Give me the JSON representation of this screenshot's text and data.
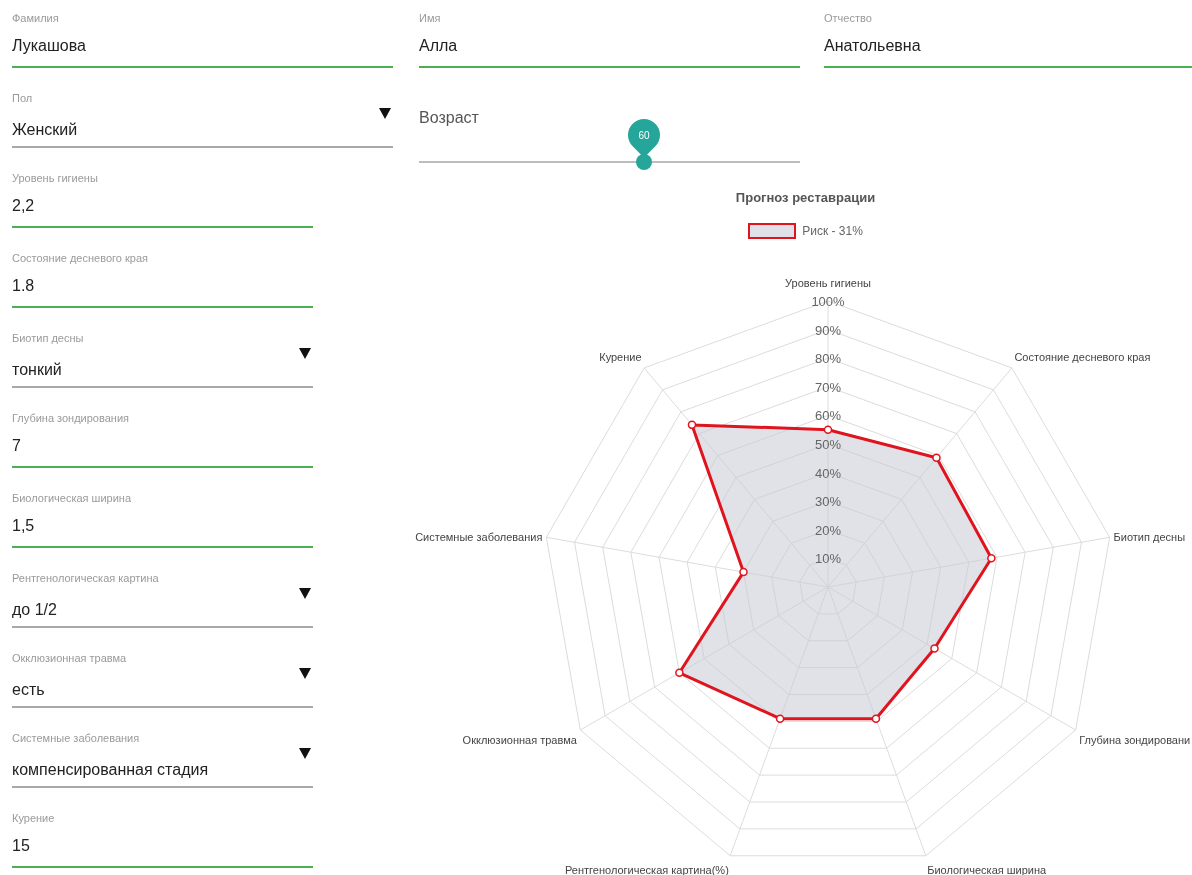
{
  "person": [
    {
      "label": "Фамилия",
      "value": "Лукашова"
    },
    {
      "label": "Имя",
      "value": "Алла"
    },
    {
      "label": "Отчество",
      "value": "Анатольевна"
    }
  ],
  "gender": {
    "kind": "select",
    "label": "Пол",
    "value": "Женский"
  },
  "clinical_fields": [
    {
      "kind": "text",
      "label": "Уровень гигиены",
      "value": "2,2"
    },
    {
      "kind": "text",
      "label": "Состояние десневого края",
      "value": "1.8"
    },
    {
      "kind": "select",
      "label": "Биотип десны",
      "value": "тонкий"
    },
    {
      "kind": "text",
      "label": "Глубина зондирования",
      "value": "7"
    },
    {
      "kind": "text",
      "label": "Биологическая ширина",
      "value": "1,5"
    },
    {
      "kind": "select",
      "label": "Рентгенологическая картина",
      "value": "до 1/2"
    },
    {
      "kind": "select",
      "label": "Окклюзионная травма",
      "value": "есть"
    },
    {
      "kind": "select",
      "label": "Системные заболевания",
      "value": "компенсированная стадия"
    },
    {
      "kind": "text",
      "label": "Курение",
      "value": "15"
    }
  ],
  "age": {
    "label": "Возраст",
    "value": "60",
    "level": 0.59
  },
  "chart": {
    "chart_data": {
      "type": "radar",
      "title": "Прогноз реставрации",
      "categories": [
        "Уровень гигиены",
        "Состояние десневого края",
        "Биотип десны",
        "Глубина зондировани",
        "Биологическая ширина",
        "Рентгенологическая картина(%)",
        "Окклюзионная травма",
        "Системные заболевания",
        "Курение"
      ],
      "series": [
        {
          "name": "Риск - 31%",
          "color": "#e0141e",
          "values": [
            55,
            59,
            58,
            43,
            49,
            49,
            60,
            30,
            74
          ]
        }
      ],
      "ylim": [
        0,
        100
      ],
      "yticks": [
        {
          "value": 10,
          "label": "10%"
        },
        {
          "value": 20,
          "label": "20%"
        },
        {
          "value": 30,
          "label": "30%"
        },
        {
          "value": 40,
          "label": "40%"
        },
        {
          "value": 50,
          "label": "50%"
        },
        {
          "value": 60,
          "label": "60%"
        },
        {
          "value": 70,
          "label": "70%"
        },
        {
          "value": 80,
          "label": "80%"
        },
        {
          "value": 90,
          "label": "90%"
        },
        {
          "value": 100,
          "label": "100%"
        }
      ]
    }
  }
}
